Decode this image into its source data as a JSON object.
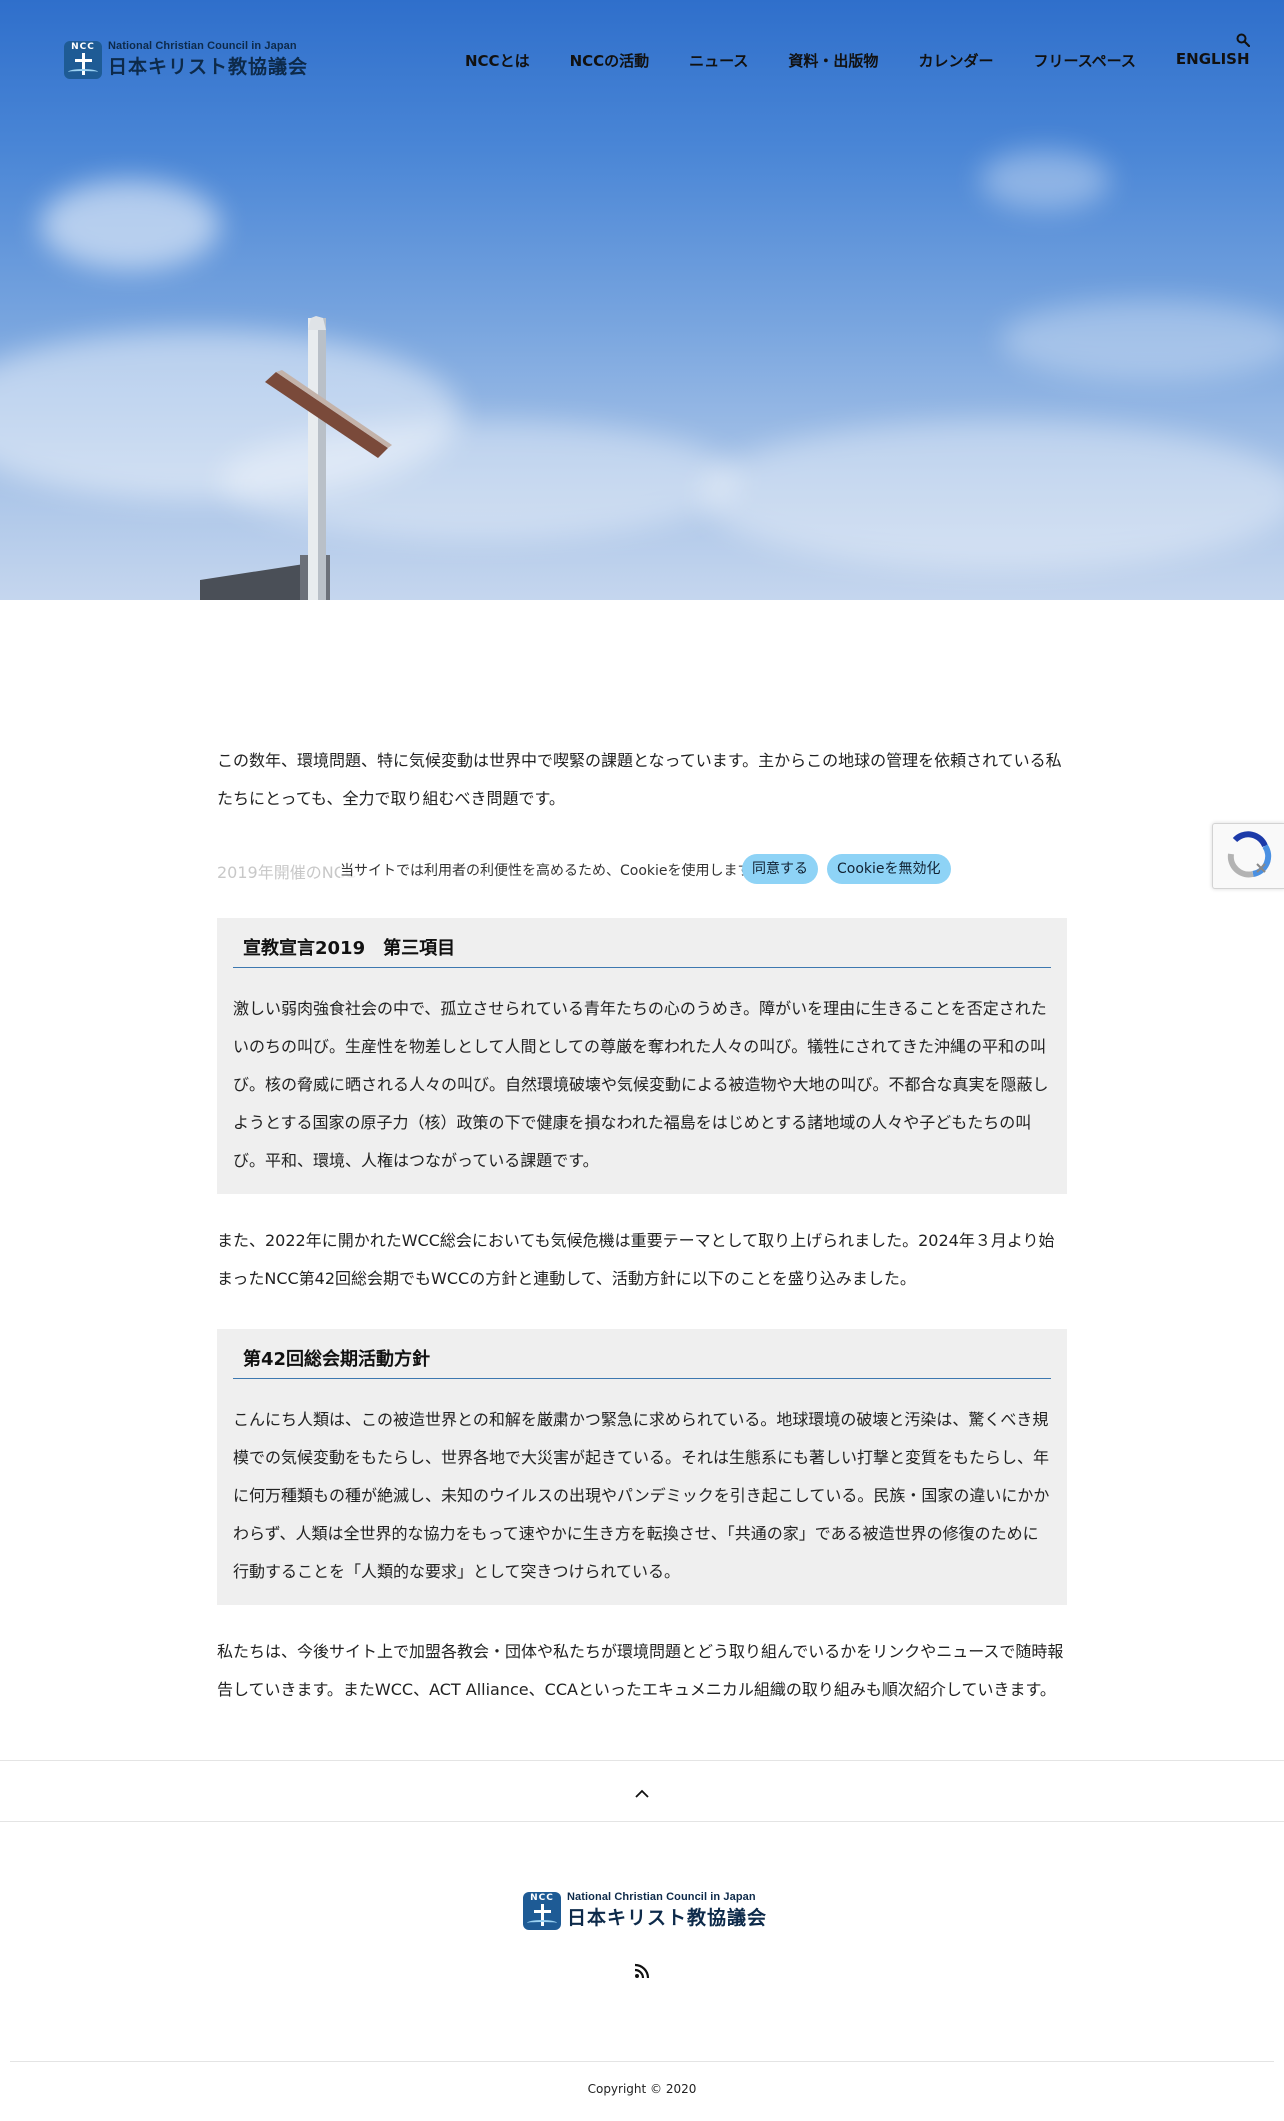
{
  "header": {
    "logo_en": "National Christian Council in Japan",
    "logo_ja": "日本キリスト教協議会",
    "logo_mark": "NCC"
  },
  "nav": {
    "items": [
      "NCCとは",
      "NCCの活動",
      "ニュース",
      "資料・出版物",
      "カレンダー",
      "フリースペース",
      "ENGLISH"
    ]
  },
  "content": {
    "intro": "この数年、環境問題、特に気候変動は世界中で喫緊の課題となっています。主からこの地球の管理を依頼されている私たちにとっても、全力で取り組むべき問題です。",
    "line_behind_cookie": "2019年開催のNCC",
    "box1": {
      "title": "宣教宣言2019　第三項目",
      "body": "激しい弱肉強食社会の中で、孤立させられている青年たちの心のうめき。障がいを理由に生きることを否定されたいのちの叫び。生産性を物差しとして人間としての尊厳を奪われた人々の叫び。犠牲にされてきた沖縄の平和の叫び。核の脅威に晒される人々の叫び。自然環境破壊や気候変動による被造物や大地の叫び。不都合な真実を隠蔽しようとする国家の原子力（核）政策の下で健康を損なわれた福島をはじめとする諸地域の人々や子どもたちの叫び。平和、環境、人権はつながっている課題です。"
    },
    "para2": "また、2022年に開かれたWCC総会においても気候危機は重要テーマとして取り上げられました。2024年３月より始まったNCC第42回総会期でもWCCの方針と連動して、活動方針に以下のことを盛り込みました。",
    "box2": {
      "title": "第42回総会期活動方針",
      "body": "こんにち人類は、この被造世界との和解を厳粛かつ緊急に求められている。地球環境の破壊と汚染は、驚くべき規模での気候変動をもたらし、世界各地で大災害が起きている。それは生態系にも著しい打撃と変質をもたらし、年に何万種類もの種が絶滅し、未知のウイルスの出現やパンデミックを引き起こしている。民族・国家の違いにかかわらず、人類は全世界的な協力をもって速やかに生き方を転換させ、「共通の家」である被造世界の修復のために行動することを「人類的な要求」として突きつけられている。"
    },
    "para3": "私たちは、今後サイト上で加盟各教会・団体や私たちが環境問題とどう取り組んでいるかをリンクやニュースで随時報告していきます。またWCC、ACT Alliance、CCAといったエキュメニカル組織の取り組みも順次紹介していきます。"
  },
  "cookie": {
    "message": "当サイトでは利用者の利便性を高めるため、Cookieを使用します。",
    "accept_label": "同意する",
    "decline_label": "Cookieを無効化"
  },
  "footer": {
    "copyright": "Copyright © 2020"
  },
  "colors": {
    "accent": "#3d78b0",
    "logo_blue": "#1e5b95",
    "cookie_button": "#8ed3f6",
    "box_bg": "#efefef"
  },
  "icons": {
    "search": "search-icon",
    "to_top": "chevron-up-icon",
    "rss": "rss-icon"
  }
}
